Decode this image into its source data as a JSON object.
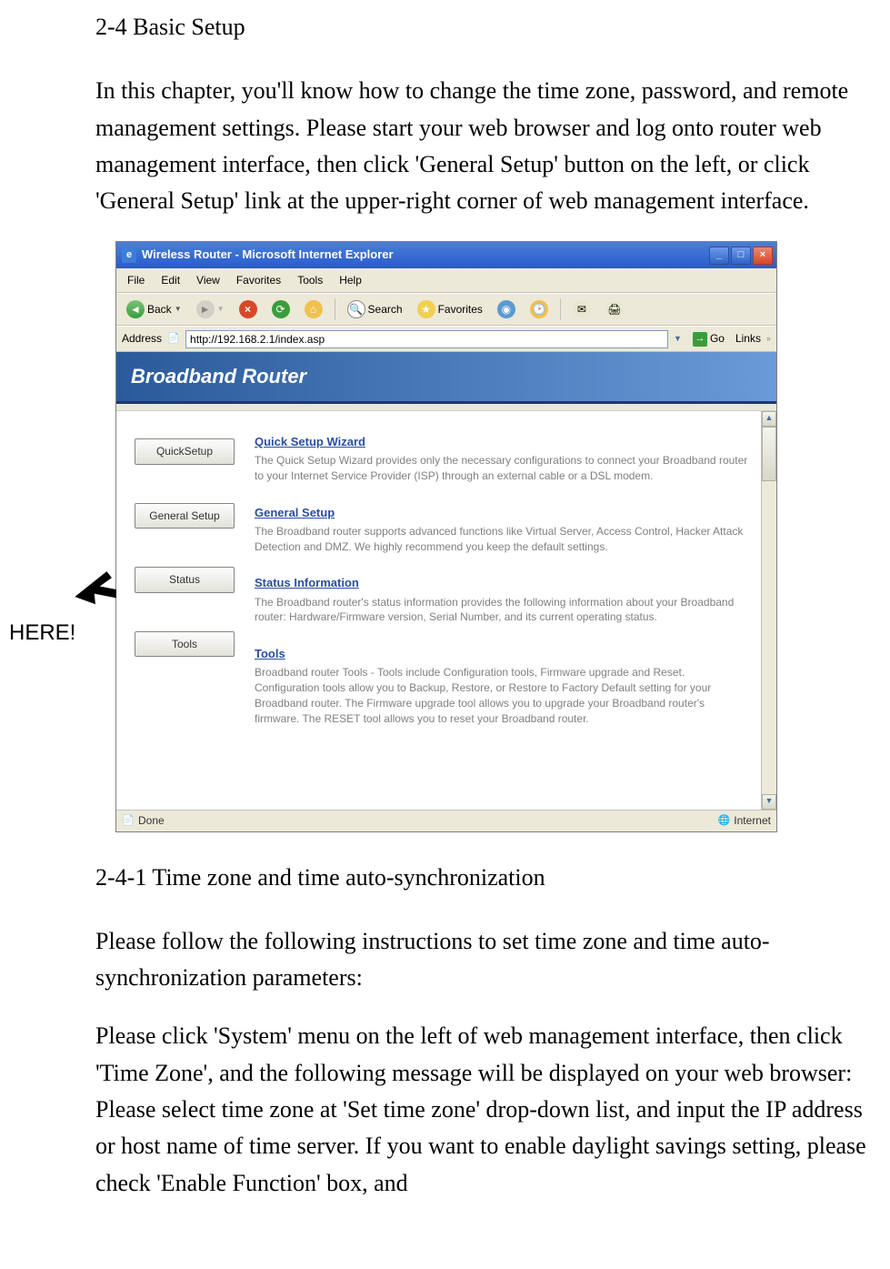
{
  "doc": {
    "heading": "2-4 Basic Setup",
    "para1": "In this chapter, you'll know how to change the time zone, password, and remote management settings. Please start your web browser and log onto router web management interface, then click 'General Setup' button on the left, or click 'General Setup' link at the upper-right corner of web management interface.",
    "subheading": "2-4-1 Time zone and time auto-synchronization",
    "para2": "Please follow the following instructions to set time zone and time auto-synchronization parameters:",
    "para3": "Please click 'System' menu on the left of web management interface, then click 'Time Zone', and the following message will be displayed on your web browser: Please select time zone at 'Set time zone' drop-down list, and input the IP address or host name of time server. If you want to enable daylight savings setting, please check 'Enable Function' box, and",
    "annotation": "HERE!"
  },
  "browser": {
    "title": "Wireless Router - Microsoft Internet Explorer",
    "menus": [
      "File",
      "Edit",
      "View",
      "Favorites",
      "Tools",
      "Help"
    ],
    "toolbar": {
      "back": "Back",
      "search": "Search",
      "favorites": "Favorites"
    },
    "address_label": "Address",
    "address_value": "http://192.168.2.1/index.asp",
    "go": "Go",
    "links": "Links",
    "status_left": "Done",
    "status_right": "Internet"
  },
  "router": {
    "brand": "Broadband Router",
    "sidebar": [
      "QuickSetup",
      "General Setup",
      "Status",
      "Tools"
    ],
    "sections": [
      {
        "title": "Quick Setup Wizard",
        "desc": "The Quick Setup Wizard provides only the necessary configurations to connect your Broadband router to your Internet Service Provider (ISP) through an external cable or a DSL modem."
      },
      {
        "title": "General Setup",
        "desc": "The Broadband router supports advanced functions like Virtual Server, Access Control, Hacker Attack Detection and DMZ. We highly recommend you keep the default settings."
      },
      {
        "title": "Status Information",
        "desc": "The Broadband router's status information provides the following information about your Broadband router: Hardware/Firmware version, Serial Number, and its current operating status."
      },
      {
        "title": "Tools",
        "desc": "Broadband router Tools - Tools include Configuration tools, Firmware upgrade and Reset. Configuration tools allow you to Backup, Restore, or Restore to Factory Default setting for your Broadband router. The Firmware upgrade tool allows you to upgrade your Broadband router's firmware. The RESET tool allows you to reset your Broadband router."
      }
    ]
  }
}
